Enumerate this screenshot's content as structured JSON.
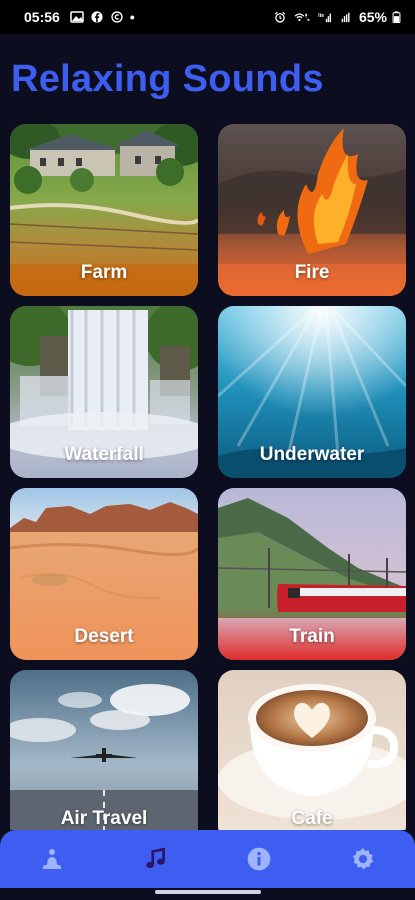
{
  "status_bar": {
    "time": "05:56",
    "dot": "•",
    "battery": "65%",
    "left_icons": [
      "gallery-icon",
      "facebook-icon",
      "copyright-icon"
    ],
    "right_icons": [
      "alarm-icon",
      "wifi-call-icon",
      "signal-icon",
      "signal-icon",
      "battery-icon"
    ]
  },
  "page": {
    "title": "Relaxing Sounds"
  },
  "sounds": [
    {
      "label": "Farm",
      "icon": "farm-scene"
    },
    {
      "label": "Fire",
      "icon": "fire-scene"
    },
    {
      "label": "Waterfall",
      "icon": "waterfall-scene"
    },
    {
      "label": "Underwater",
      "icon": "underwater-scene"
    },
    {
      "label": "Desert",
      "icon": "desert-scene"
    },
    {
      "label": "Train",
      "icon": "train-scene"
    },
    {
      "label": "Air Travel",
      "icon": "airplane-scene"
    },
    {
      "label": "Cafe",
      "icon": "coffee-scene"
    }
  ],
  "bottom_nav": {
    "items": [
      {
        "icon": "meditation-icon",
        "active": false
      },
      {
        "icon": "music-note-icon",
        "active": true
      },
      {
        "icon": "info-icon",
        "active": false
      },
      {
        "icon": "settings-icon",
        "active": false
      }
    ]
  },
  "colors": {
    "background": "#0c0e1f",
    "accent": "#3d5ef0",
    "nav_icon": "#9fb4ff",
    "nav_icon_active": "#2a1466"
  }
}
